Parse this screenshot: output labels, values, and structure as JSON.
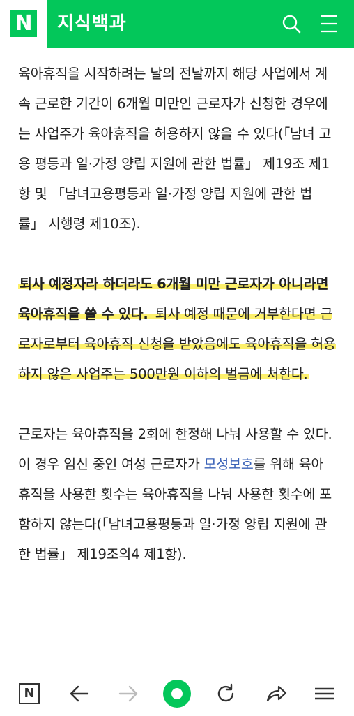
{
  "header": {
    "logo_letter": "N",
    "title": "지식백과",
    "icons": [
      "search-icon",
      "menu-icon"
    ],
    "brand_color": "#03c75a"
  },
  "paragraphs": {
    "p1": "육아휴직을 시작하려는 날의 전날까지 해당 사업에서 계속 근로한 기간이 6개월 미만인 근로자가 신청한 경우에는 사업주가 육아휴직을 허용하지 않을 수 있다(「남녀 고용 평등과 일·가정 양립 지원에 관한 법률」 제19조 제1항 및 「남녀고용평등과 일·가정 양립 지원에 관한 법률」 시행령 제10조).",
    "p2_bold": "퇴사 예정자라 하더라도 6개월 미만 근로자가 아니라면 육아휴직을 쓸 수 있다.",
    "p2_rest": " 퇴사 예정 때문에 거부한다면  근로자로부터 육아휴직 신청을 받았음에도 육아휴직을 허용하지 않은 사업주는 500만원 이하의 벌금에 처한다.",
    "p3_before": "근로자는 육아휴직을 2회에 한정해 나눠 사용할 수 있다. 이 경우 임신 중인 여성 근로자가 ",
    "p3_link": "모성보호",
    "p3_after": "를 위해 육아휴직을 사용한 횟수는 육아휴직을 나눠 사용한 횟수에 포함하지 않는다(「남녀고용평등과 일·가정 양립 지원에 관한 법률」 제19조의4 제1항)."
  },
  "highlight_color": "#fdf06b",
  "link_color": "#3b63b8",
  "bottom_nav": {
    "n_label": "N",
    "items": [
      "naver-home-icon",
      "back-arrow-icon",
      "forward-arrow-icon",
      "green-dot-button",
      "refresh-icon",
      "share-icon",
      "hamburger-menu-icon"
    ]
  }
}
